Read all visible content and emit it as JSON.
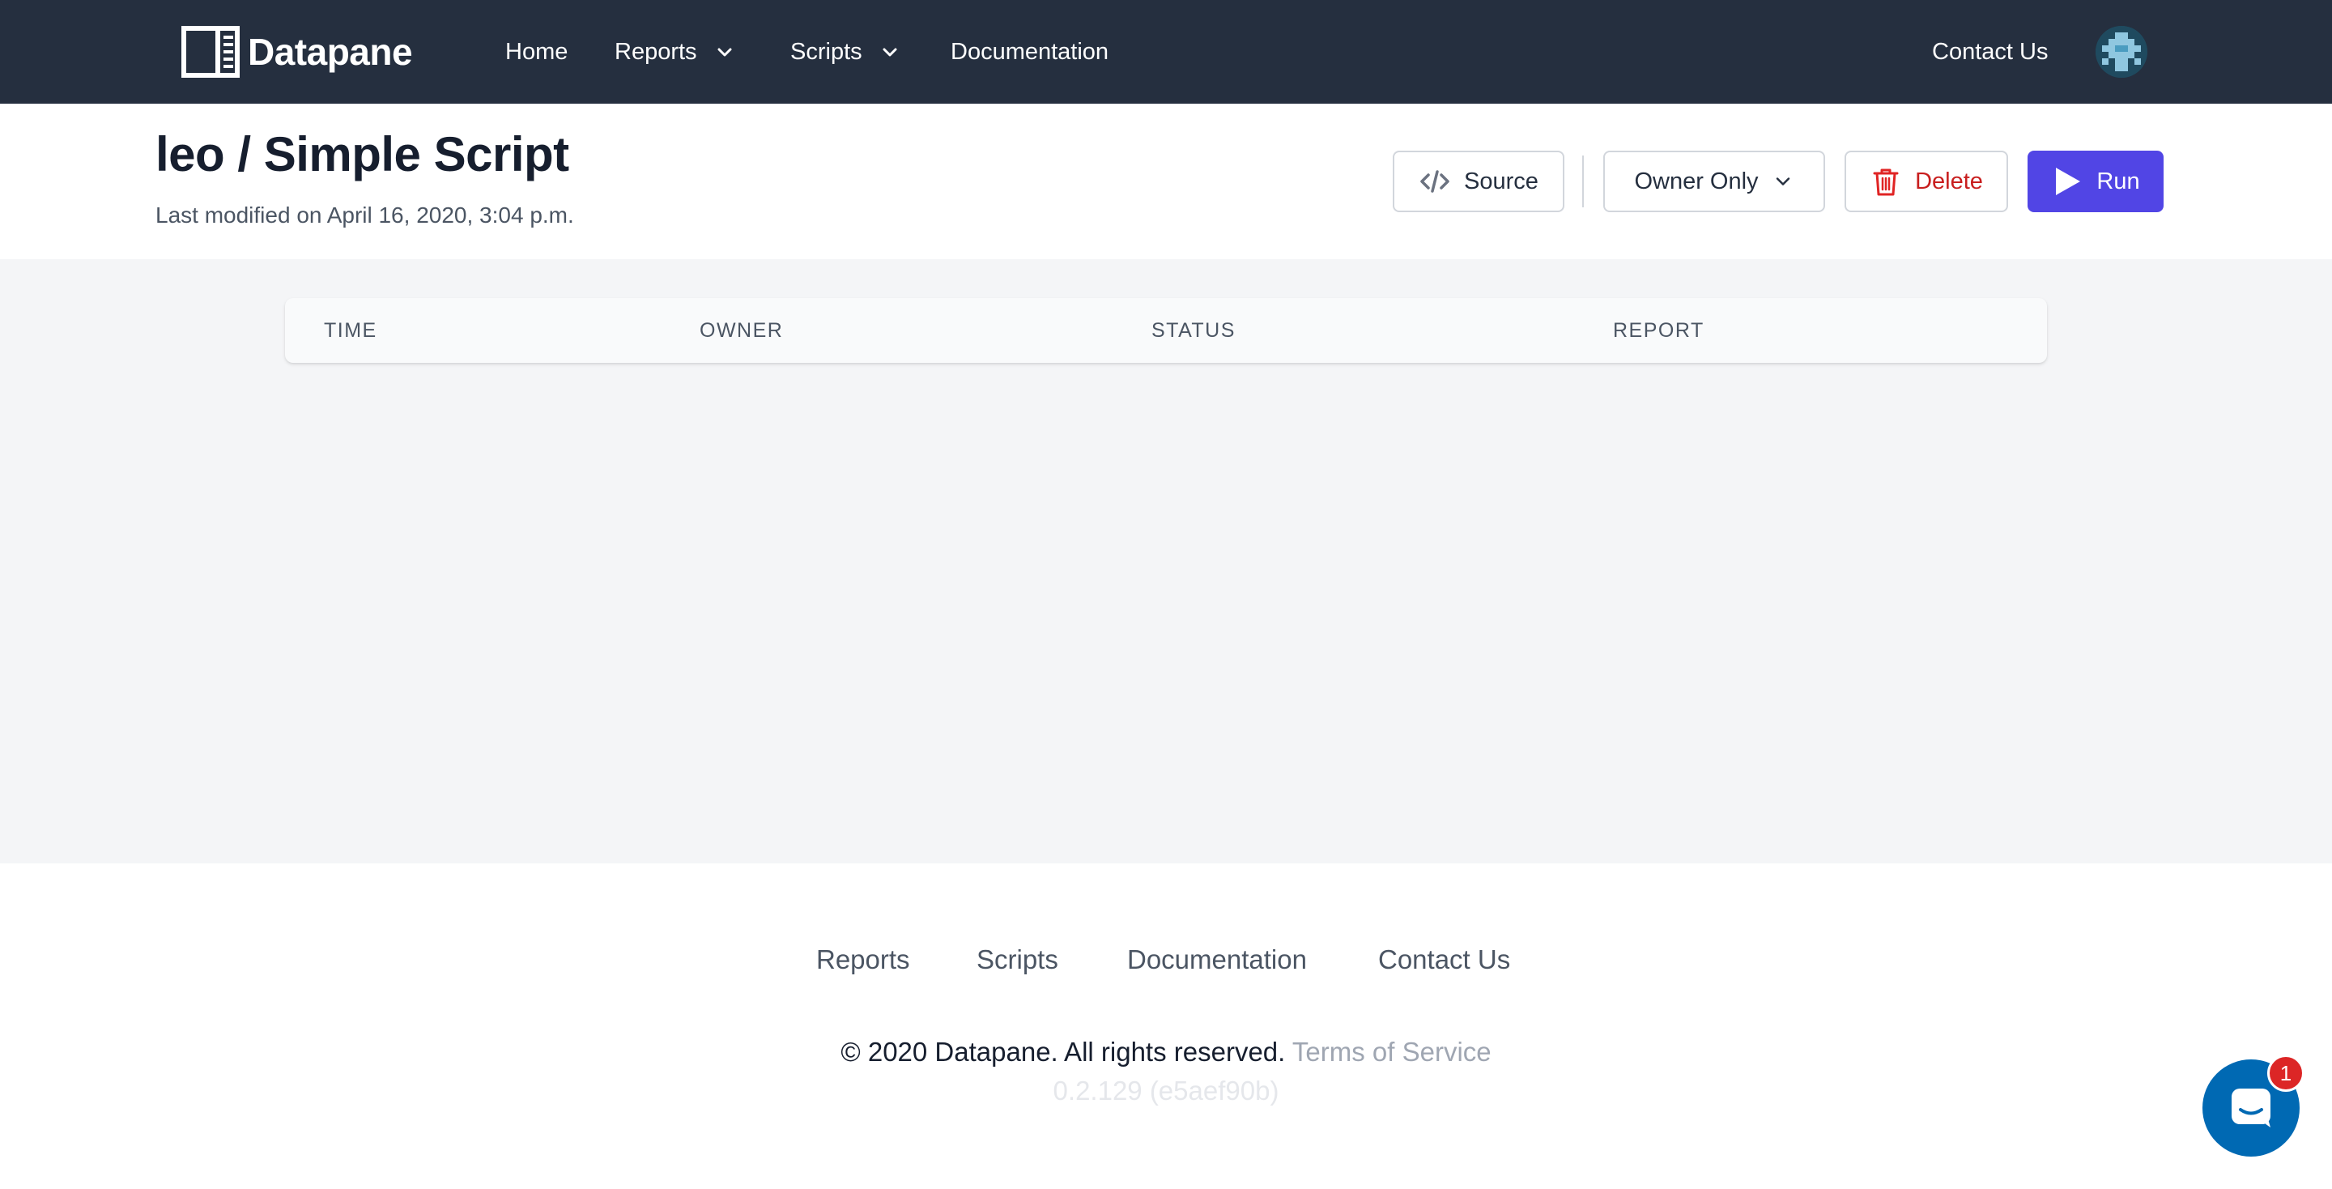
{
  "navbar": {
    "brand": "Datapane",
    "items": [
      {
        "label": "Home"
      },
      {
        "label": "Reports"
      },
      {
        "label": "Scripts"
      },
      {
        "label": "Documentation"
      }
    ],
    "contact": "Contact Us",
    "avatar_icon": "user-avatar"
  },
  "header": {
    "title": "leo / Simple Script",
    "subtitle": "Last modified on April 16, 2020, 3:04 p.m.",
    "buttons": {
      "source": "Source",
      "visibility": "Owner Only",
      "delete": "Delete",
      "run": "Run"
    }
  },
  "table": {
    "columns": [
      "TIME",
      "OWNER",
      "STATUS",
      "REPORT"
    ],
    "rows": []
  },
  "footer": {
    "links": [
      "Reports",
      "Scripts",
      "Documentation",
      "Contact Us"
    ],
    "copyright": "© 2020 Datapane. All rights reserved.",
    "terms": "Terms of Service",
    "version": "0.2.129 (e5aef90b)"
  },
  "chat": {
    "badge_count": "1",
    "icon": "chat-icon"
  },
  "colors": {
    "navbar_bg": "#252f3f",
    "primary": "#5145e5",
    "danger": "#c81e1e",
    "chat": "#0069b3"
  }
}
